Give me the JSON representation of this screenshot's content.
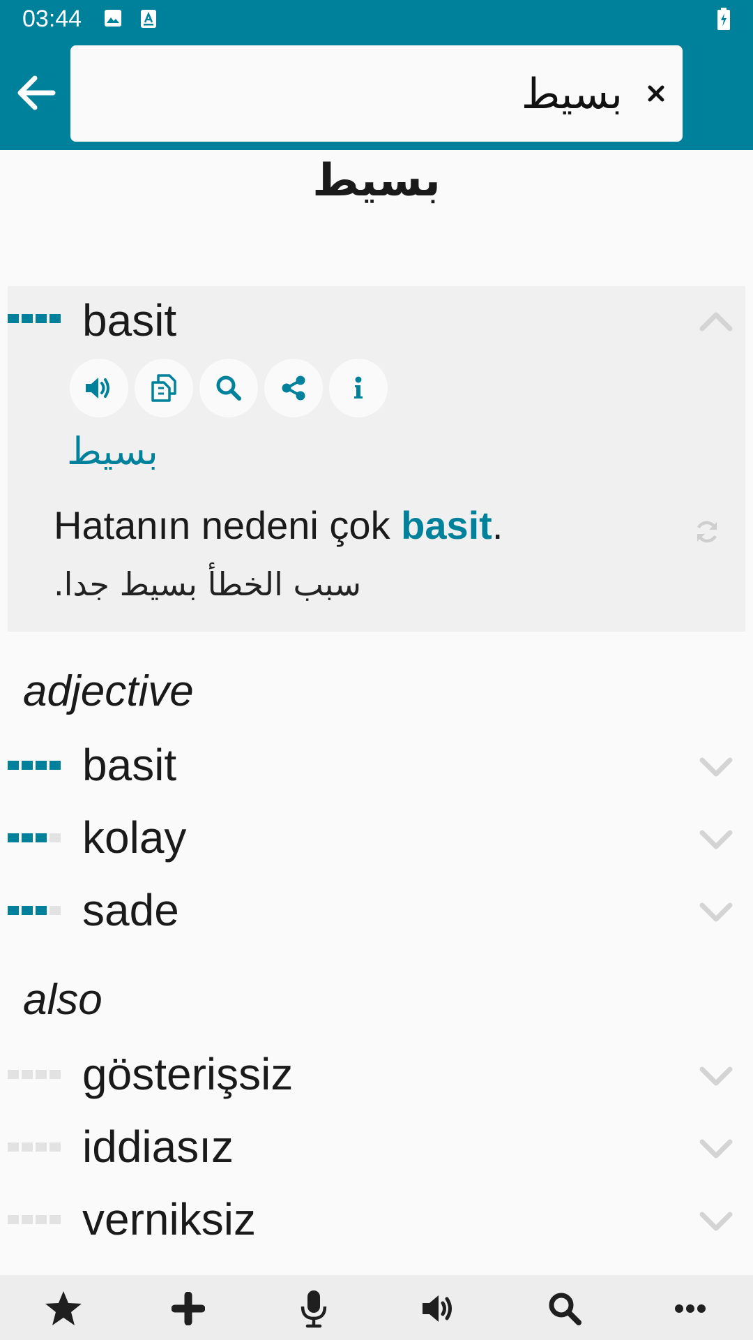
{
  "status": {
    "time": "03:44"
  },
  "search": {
    "query": "بسيط"
  },
  "headword": "بسيط",
  "expanded": {
    "term": "basit",
    "frequency": 4,
    "source_word": "بسيط",
    "example_before": "Hatanın nedeni çok ",
    "example_highlight": "basit",
    "example_after": ".",
    "example_translation": "سبب الخطأ بسيط جدا."
  },
  "actions": [
    "speaker-icon",
    "copy-icon",
    "search-icon",
    "share-icon",
    "info-icon"
  ],
  "sections": [
    {
      "label": "adjective",
      "items": [
        {
          "term": "basit",
          "frequency": 4
        },
        {
          "term": "kolay",
          "frequency": 3
        },
        {
          "term": "sade",
          "frequency": 3
        }
      ]
    },
    {
      "label": "also",
      "items": [
        {
          "term": "gösterişsiz",
          "frequency": 0
        },
        {
          "term": "iddiasız",
          "frequency": 0
        },
        {
          "term": "verniksiz",
          "frequency": 0
        }
      ]
    }
  ],
  "bottom_nav": [
    "star-icon",
    "plus-icon",
    "microphone-icon",
    "speaker-icon",
    "search-icon",
    "more-icon"
  ],
  "colors": {
    "accent": "#00819b",
    "card": "#f0f0f0",
    "background": "#fafafa"
  }
}
